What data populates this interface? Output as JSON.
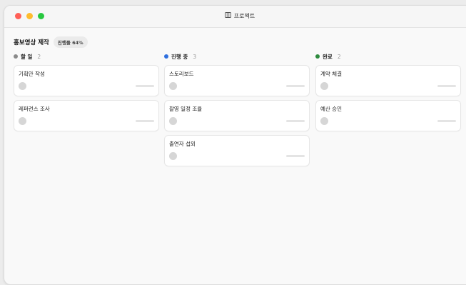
{
  "window": {
    "title": "프로젝트",
    "title_icon": "kanban-board-icon"
  },
  "project": {
    "name": "홍보영상 제작",
    "progress_label": "진행률 64%",
    "progress_value": 64
  },
  "columns": [
    {
      "key": "todo",
      "title": "할 일",
      "count": "2",
      "color": "#8a8a8a",
      "cards": [
        {
          "title": "기획안 작성"
        },
        {
          "title": "레퍼런스 조사"
        }
      ]
    },
    {
      "key": "in-progress",
      "title": "진행 중",
      "count": "3",
      "color": "#2f6fde",
      "cards": [
        {
          "title": "스토리보드"
        },
        {
          "title": "촬영 일정 조율"
        },
        {
          "title": "출연자 섭외"
        }
      ]
    },
    {
      "key": "done",
      "title": "완료",
      "count": "2",
      "color": "#2e8b3e",
      "cards": [
        {
          "title": "계약 체결"
        },
        {
          "title": "예산 승인"
        }
      ]
    }
  ]
}
